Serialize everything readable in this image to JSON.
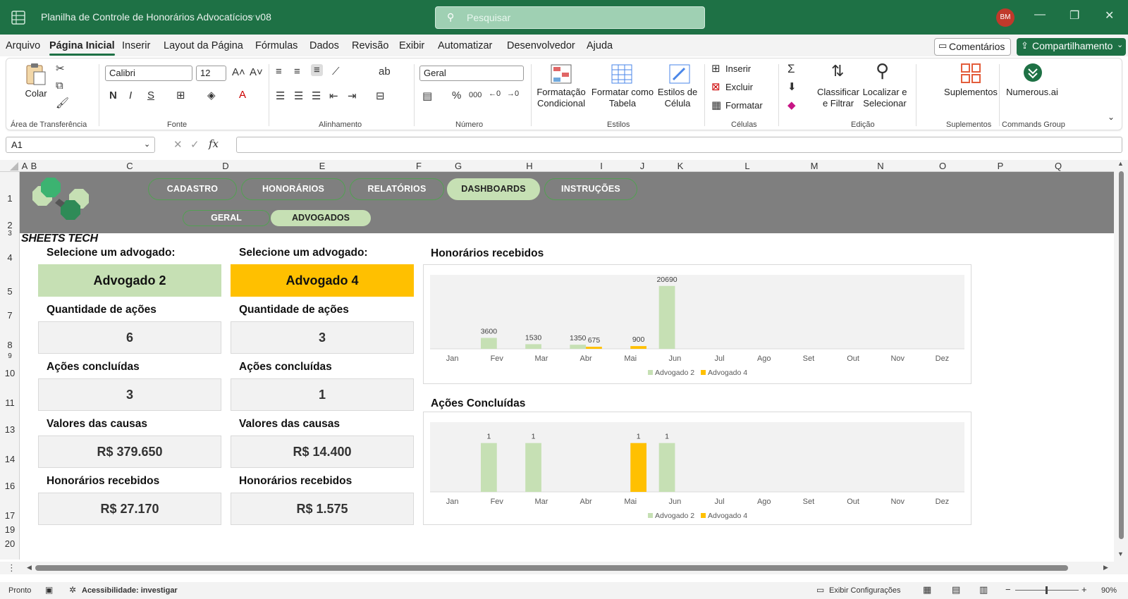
{
  "window": {
    "title": "Planilha de Controle de Honorários Advocatícios v08",
    "search_placeholder": "Pesquisar",
    "user_initials": "BM"
  },
  "menu": {
    "items": [
      "Arquivo",
      "Página Inicial",
      "Inserir",
      "Layout da Página",
      "Fórmulas",
      "Dados",
      "Revisão",
      "Exibir",
      "Automatizar",
      "Desenvolvedor",
      "Ajuda"
    ],
    "active": "Página Inicial",
    "comments_label": "Comentários",
    "share_label": "Compartilhamento"
  },
  "ribbon": {
    "paste_label": "Colar",
    "clipboard_group": "Área de Transferência",
    "font_group": "Fonte",
    "font_name": "Calibri",
    "font_size": "12",
    "alignment_group": "Alinhamento",
    "number_group": "Número",
    "number_format": "Geral",
    "conditional_label_1": "Formatação",
    "conditional_label_2": "Condicional",
    "format_table_label_1": "Formatar como",
    "format_table_label_2": "Tabela",
    "cell_styles_label_1": "Estilos de",
    "cell_styles_label_2": "Célula",
    "styles_group": "Estilos",
    "insert_label": "Inserir",
    "delete_label": "Excluir",
    "format_label": "Formatar",
    "cells_group": "Células",
    "sort_label_1": "Classificar",
    "sort_label_2": "e Filtrar",
    "find_label_1": "Localizar e",
    "find_label_2": "Selecionar",
    "editing_group": "Edição",
    "addins_label": "Suplementos",
    "addins_group": "Suplementos",
    "numerous_label": "Numerous.ai",
    "commands_group": "Commands Group"
  },
  "formula_bar": {
    "name_box": "A1",
    "formula": ""
  },
  "grid": {
    "columns": [
      "A",
      "B",
      "C",
      "D",
      "E",
      "F",
      "G",
      "H",
      "I",
      "J",
      "K",
      "L",
      "M",
      "N",
      "O",
      "P",
      "Q"
    ],
    "rows": [
      "1",
      "2",
      "3",
      "4",
      "5",
      "7",
      "8",
      "9",
      "10",
      "11",
      "13",
      "14",
      "16",
      "17",
      "19",
      "20"
    ]
  },
  "sheet": {
    "brand": "SHEETS TECH",
    "nav": [
      "CADASTRO",
      "HONORÁRIOS",
      "RELATÓRIOS",
      "DASHBOARDS",
      "INSTRUÇÕES"
    ],
    "nav_active": "DASHBOARDS",
    "subnav": [
      "GERAL",
      "ADVOGADOS"
    ],
    "subnav_active": "ADVOGADOS",
    "left": {
      "select_label": "Selecione um advogado:",
      "selected": "Advogado 2",
      "color": "#c6e0b4",
      "qty_label": "Quantidade de ações",
      "qty_value": "6",
      "done_label": "Ações concluídas",
      "done_value": "3",
      "values_label": "Valores das causas",
      "values_value": "R$ 379.650",
      "fees_label": "Honorários recebidos",
      "fees_value": "R$ 27.170"
    },
    "right": {
      "select_label": "Selecione um advogado:",
      "selected": "Advogado 4",
      "color": "#ffc000",
      "qty_label": "Quantidade de ações",
      "qty_value": "3",
      "done_label": "Ações concluídas",
      "done_value": "1",
      "values_label": "Valores das causas",
      "values_value": "R$ 14.400",
      "fees_label": "Honorários recebidos",
      "fees_value": "R$ 1.575"
    }
  },
  "chart_data": [
    {
      "type": "bar",
      "title": "Honorários recebidos",
      "categories": [
        "Jan",
        "Fev",
        "Mar",
        "Abr",
        "Mai",
        "Jun",
        "Jul",
        "Ago",
        "Set",
        "Out",
        "Nov",
        "Dez"
      ],
      "series": [
        {
          "name": "Advogado 2",
          "color": "#c6e0b4",
          "values": [
            0,
            3600,
            1530,
            1350,
            0,
            20690,
            0,
            0,
            0,
            0,
            0,
            0
          ]
        },
        {
          "name": "Advogado 4",
          "color": "#ffc000",
          "values": [
            0,
            0,
            0,
            675,
            900,
            0,
            0,
            0,
            0,
            0,
            0,
            0
          ]
        }
      ],
      "legend": "bottom"
    },
    {
      "type": "bar",
      "title": "Ações Concluídas",
      "categories": [
        "Jan",
        "Fev",
        "Mar",
        "Abr",
        "Mai",
        "Jun",
        "Jul",
        "Ago",
        "Set",
        "Out",
        "Nov",
        "Dez"
      ],
      "series": [
        {
          "name": "Advogado 2",
          "color": "#c6e0b4",
          "values": [
            0,
            1,
            1,
            0,
            0,
            1,
            0,
            0,
            0,
            0,
            0,
            0
          ]
        },
        {
          "name": "Advogado 4",
          "color": "#ffc000",
          "values": [
            0,
            0,
            0,
            0,
            1,
            0,
            0,
            0,
            0,
            0,
            0,
            0
          ]
        }
      ],
      "legend": "bottom"
    }
  ],
  "status": {
    "ready": "Pronto",
    "accessibility": "Acessibilidade: investigar",
    "display_settings": "Exibir Configurações",
    "zoom": "90%"
  }
}
